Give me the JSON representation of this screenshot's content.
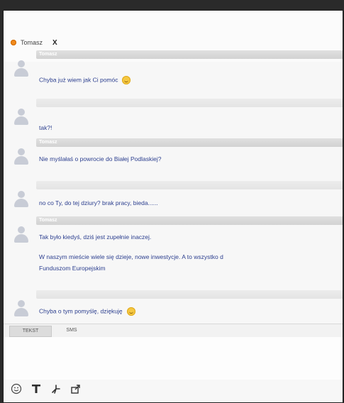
{
  "tab": {
    "title": "Tomasz",
    "close_label": "X"
  },
  "messages": [
    {
      "sender": "Tomasz",
      "text": "Chyba już wiem jak Ci pomóc",
      "emoji": "smiley"
    },
    {
      "sender": "",
      "text": "tak?!"
    },
    {
      "sender": "Tomasz",
      "text": "Nie myślałaś o powrocie do Białej Podlaskiej?"
    },
    {
      "sender": "",
      "text": "no co Ty, do tej dziury? brak pracy, bieda......"
    },
    {
      "sender": "Tomasz",
      "text": "Tak było kiedyś, dziś jest zupełnie inaczej.",
      "text2": "W naszym mieście wiele się dzieje, nowe inwestycje. A to wszystko d",
      "text3": "Funduszom Europejskim"
    },
    {
      "sender": "",
      "text": "Chyba o tym pomyślę, dziękuję",
      "emoji": "smiley"
    }
  ],
  "modes": {
    "text": "TEKST",
    "sms": "SMS",
    "active": "TEKST"
  },
  "toolbar": {
    "icons": [
      "smiley-icon",
      "text-format-icon",
      "nudge-icon",
      "share-icon"
    ]
  }
}
